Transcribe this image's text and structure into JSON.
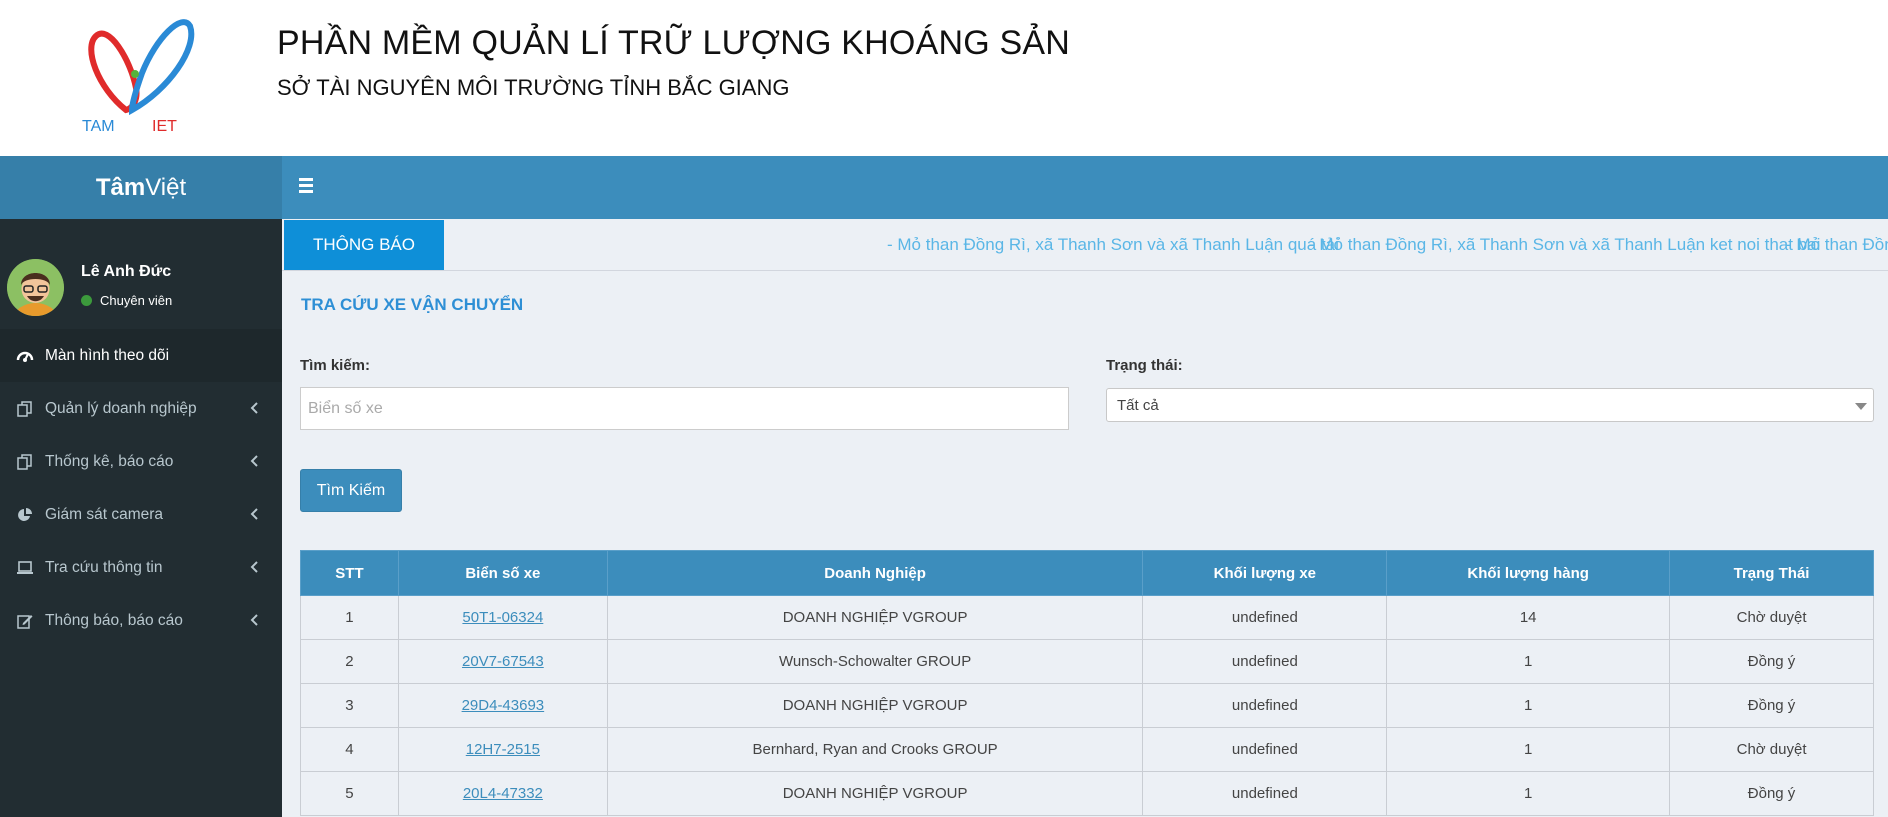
{
  "banner": {
    "title": "PHẦN MỀM QUẢN LÍ TRỮ LƯỢNG KHOÁNG SẢN",
    "subtitle": "SỞ TÀI NGUYÊN MÔI TRƯỜNG TỈNH BẮC GIANG",
    "logo_text_left": "TAM",
    "logo_text_right": "IET"
  },
  "brand": {
    "bold": "Tâm",
    "normal": "Việt"
  },
  "user": {
    "name": "Lê Anh Đức",
    "role": "Chuyên viên",
    "status_color": "#3c9a3c"
  },
  "sidebar": {
    "items": [
      {
        "label": "Màn hình theo dõi",
        "icon": "dashboard-icon",
        "active": true
      },
      {
        "label": "Quản lý doanh nghiệp",
        "icon": "copy-icon"
      },
      {
        "label": "Thống kê, báo cáo",
        "icon": "copy-icon"
      },
      {
        "label": "Giám sát camera",
        "icon": "pie-chart-icon"
      },
      {
        "label": "Tra cứu thông tin",
        "icon": "laptop-icon"
      },
      {
        "label": "Thông báo, báo cáo",
        "icon": "edit-icon"
      }
    ]
  },
  "notice": {
    "label": "THÔNG BÁO",
    "messages": [
      "- Mỏ than Đồng Rì, xã Thanh Sơn và xã Thanh Luận quá tải",
      "- Mỏ than Đồng Rì, xã Thanh Sơn và xã Thanh Luận ket noi that bai",
      "- Mỏ than Đồng Rì, xã Th"
    ]
  },
  "section_title": "TRA CỨU XE VẬN CHUYỂN",
  "search": {
    "label": "Tìm kiếm:",
    "placeholder": "Biển số xe",
    "value": ""
  },
  "status_filter": {
    "label": "Trạng thái:",
    "selected": "Tất cả"
  },
  "search_button": "Tìm Kiếm",
  "table": {
    "headers": [
      "STT",
      "Biển số xe",
      "Doanh Nghiệp",
      "Khối lượng xe",
      "Khối lượng hàng",
      "Trạng Thái"
    ],
    "rows": [
      [
        "1",
        "50T1-06324",
        "DOANH NGHIỆP VGROUP",
        "undefined",
        "14",
        "Chờ duyệt"
      ],
      [
        "2",
        "20V7-67543",
        "Wunsch-Schowalter GROUP",
        "undefined",
        "1",
        "Đồng ý"
      ],
      [
        "3",
        "29D4-43693",
        "DOANH NGHIỆP VGROUP",
        "undefined",
        "1",
        "Đồng ý"
      ],
      [
        "4",
        "12H7-2515",
        "Bernhard, Ryan and Crooks GROUP",
        "undefined",
        "1",
        "Chờ duyệt"
      ],
      [
        "5",
        "20L4-47332",
        "DOANH NGHIỆP VGROUP",
        "undefined",
        "1",
        "Đồng ý"
      ]
    ]
  },
  "colors": {
    "primary": "#3c8dbc",
    "sidebar_bg": "#222d32",
    "notice_accent": "#0e8fd8",
    "marquee_text": "#5ab6e6"
  }
}
